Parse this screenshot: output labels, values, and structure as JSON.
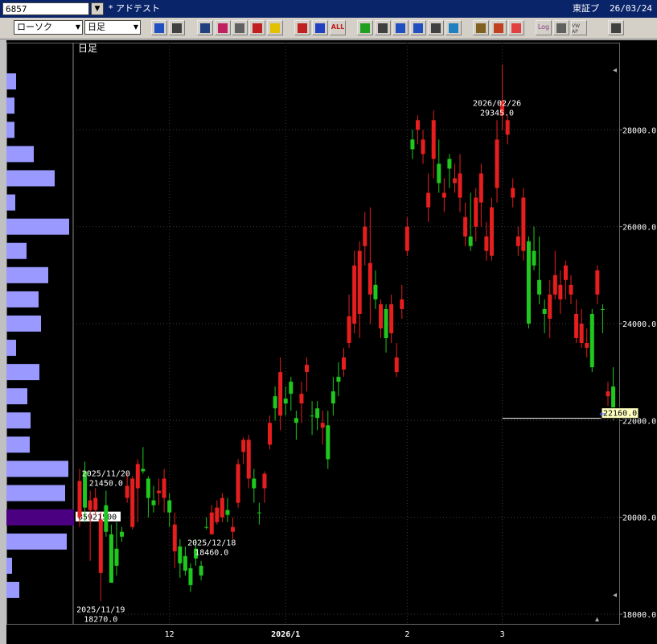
{
  "window": {
    "code": "6857",
    "title": "* アドテスト",
    "market": "東証プ",
    "date": "26/03/24"
  },
  "toolbar": {
    "chart_type": "ローソク",
    "period": "日足",
    "buttons": [
      {
        "name": "zoom-icon",
        "color": "#2050c0"
      },
      {
        "name": "columns-icon",
        "color": "#404040"
      },
      {
        "name": "pointer-icon",
        "color": "#204080"
      },
      {
        "name": "magnifier-icon",
        "color": "#c02060"
      },
      {
        "name": "table-icon",
        "color": "#606060"
      },
      {
        "name": "compare-icon",
        "color": "#c02020"
      },
      {
        "name": "warning-icon",
        "color": "#e0c000"
      },
      {
        "name": "candle-red-icon",
        "color": "#c02020"
      },
      {
        "name": "candle-blue-icon",
        "color": "#2040c0"
      },
      {
        "name": "all-icon",
        "color": "#c02020"
      },
      {
        "name": "pencil-icon",
        "color": "#20a020"
      },
      {
        "name": "line-tool-icon",
        "color": "#404040"
      },
      {
        "name": "cursor-icon",
        "color": "#2050c0"
      },
      {
        "name": "arrow-curve-icon",
        "color": "#2050c0"
      },
      {
        "name": "document-icon",
        "color": "#404040"
      },
      {
        "name": "bucket-icon",
        "color": "#2080c0"
      },
      {
        "name": "settings-icon",
        "color": "#806020"
      },
      {
        "name": "wrench-icon",
        "color": "#c04020"
      },
      {
        "name": "palette-icon",
        "color": "#e04040"
      },
      {
        "name": "log-icon",
        "color": "#804080"
      },
      {
        "name": "nav-icon",
        "color": "#606060"
      },
      {
        "name": "vwap-icon",
        "color": "#404040"
      },
      {
        "name": "layout-icon",
        "color": "#404040"
      }
    ],
    "log_label": "Log",
    "all_label": "ALL",
    "vwap_label": "VW AP"
  },
  "chart_data": {
    "type": "candlestick",
    "period_label": "日足",
    "ylim": [
      17800,
      29800
    ],
    "y_ticks": [
      {
        "v": 18000,
        "label": "18000.0"
      },
      {
        "v": 20000,
        "label": "20000.0"
      },
      {
        "v": 22000,
        "label": "22000.0"
      },
      {
        "v": 24000,
        "label": "24000.0"
      },
      {
        "v": 26000,
        "label": "26000.0"
      },
      {
        "v": 28000,
        "label": "28000.0"
      }
    ],
    "x_ticks": [
      {
        "i": 17,
        "label": "12"
      },
      {
        "i": 39,
        "label": "2026/1"
      },
      {
        "i": 62,
        "label": "2"
      },
      {
        "i": 80,
        "label": "3"
      }
    ],
    "current_price": 22160.0,
    "current_label": "22160.0",
    "volume_profile_label": "85921500",
    "annotations": [
      {
        "date": "2025/11/19",
        "value": "18270.0",
        "i": 4,
        "pos": "below"
      },
      {
        "date": "2025/11/20",
        "value": "21450.0",
        "i": 5,
        "pos": "above"
      },
      {
        "date": "2025/12/18",
        "value": "18460.0",
        "i": 25,
        "pos": "below"
      },
      {
        "date": "2026/02/26",
        "value": "29345.0",
        "i": 79,
        "pos": "above"
      }
    ],
    "candles": [
      [
        20750,
        20000,
        21000,
        19800
      ],
      [
        20200,
        20950,
        21150,
        19900
      ],
      [
        20350,
        20150,
        20550,
        19100
      ],
      [
        20400,
        20150,
        20600,
        20050
      ],
      [
        19950,
        18850,
        20100,
        18270
      ],
      [
        19700,
        20250,
        20550,
        19600
      ],
      [
        18650,
        19650,
        19850,
        18700
      ],
      [
        19000,
        19350,
        19900,
        18800
      ],
      [
        19600,
        19700,
        19800,
        19500
      ],
      [
        20650,
        20400,
        20900,
        20300
      ],
      [
        20800,
        19800,
        20850,
        19750
      ],
      [
        21100,
        20600,
        21200,
        19900
      ],
      [
        20950,
        21000,
        21450,
        20900
      ],
      [
        20400,
        20800,
        20850,
        20000
      ],
      [
        20250,
        20350,
        20650,
        20100
      ],
      [
        20550,
        20500,
        20800,
        20250
      ],
      [
        20800,
        20400,
        21000,
        20100
      ],
      [
        20100,
        20350,
        20500,
        19800
      ],
      [
        19850,
        19300,
        20100,
        18950
      ],
      [
        19050,
        19400,
        19550,
        18750
      ],
      [
        18900,
        19200,
        19400,
        18800
      ],
      [
        18600,
        18950,
        19050,
        18460
      ],
      [
        19150,
        19350,
        19550,
        19000
      ],
      [
        18800,
        19000,
        19100,
        18700
      ],
      [
        19800,
        19800,
        20000,
        19750
      ],
      [
        20100,
        19650,
        20250,
        19650
      ],
      [
        20200,
        19900,
        20350,
        19850
      ],
      [
        20400,
        20000,
        20500,
        19900
      ],
      [
        20050,
        20150,
        20400,
        19900
      ],
      [
        19800,
        19700,
        20000,
        19550
      ],
      [
        21100,
        20300,
        21200,
        20200
      ],
      [
        21600,
        21350,
        21650,
        21100
      ],
      [
        21600,
        20800,
        21700,
        20600
      ],
      [
        20600,
        20800,
        21000,
        20300
      ],
      [
        20100,
        20100,
        20300,
        19850
      ],
      [
        20900,
        20600,
        20950,
        20300
      ],
      [
        21950,
        21500,
        22100,
        21400
      ],
      [
        22250,
        22500,
        22700,
        22000
      ],
      [
        23000,
        22100,
        23300,
        21800
      ],
      [
        22350,
        22450,
        22700,
        22100
      ],
      [
        22550,
        22800,
        22900,
        22200
      ],
      [
        21950,
        22050,
        22200,
        21600
      ],
      [
        22550,
        22350,
        22800,
        21950
      ],
      [
        23150,
        23000,
        23300,
        22600
      ],
      [
        22100,
        22100,
        22400,
        21700
      ],
      [
        22050,
        22250,
        22400,
        21800
      ],
      [
        21950,
        21850,
        22200,
        21500
      ],
      [
        21200,
        21900,
        22200,
        21000
      ],
      [
        22350,
        22600,
        22900,
        22100
      ],
      [
        22800,
        22900,
        23200,
        22500
      ],
      [
        23300,
        23050,
        23500,
        22900
      ],
      [
        24150,
        23600,
        24600,
        23500
      ],
      [
        25200,
        24000,
        25500,
        23800
      ],
      [
        25500,
        24200,
        25700,
        23700
      ],
      [
        26000,
        25600,
        26300,
        25200
      ],
      [
        25250,
        24600,
        26400,
        24000
      ],
      [
        24500,
        24800,
        25100,
        24300
      ],
      [
        24400,
        23900,
        24500,
        23700
      ],
      [
        23700,
        24300,
        24400,
        23400
      ],
      [
        24400,
        23800,
        24600,
        23600
      ],
      [
        23300,
        23000,
        23600,
        22900
      ],
      [
        24500,
        24300,
        24800,
        24100
      ],
      [
        26000,
        25500,
        26200,
        25400
      ],
      [
        27600,
        27800,
        28000,
        27400
      ],
      [
        28200,
        28000,
        28300,
        27700
      ],
      [
        27800,
        27500,
        28000,
        27300
      ],
      [
        26700,
        26400,
        27100,
        26100
      ],
      [
        28200,
        27400,
        28400,
        27000
      ],
      [
        26900,
        27300,
        27800,
        26700
      ],
      [
        26700,
        26600,
        27000,
        26300
      ],
      [
        27200,
        27400,
        27500,
        26800
      ],
      [
        27000,
        26900,
        27300,
        26700
      ],
      [
        27100,
        26600,
        27500,
        26300
      ],
      [
        26200,
        25800,
        26500,
        25600
      ],
      [
        25600,
        25800,
        26700,
        25500
      ],
      [
        26600,
        26000,
        26800,
        25700
      ],
      [
        27100,
        26500,
        27300,
        26000
      ],
      [
        25800,
        25500,
        26100,
        25300
      ],
      [
        26400,
        25400,
        26600,
        25300
      ],
      [
        27800,
        26800,
        28200,
        26500
      ],
      [
        28600,
        28300,
        29345,
        28000
      ],
      [
        28200,
        27900,
        28300,
        27700
      ],
      [
        26800,
        26600,
        27000,
        26400
      ],
      [
        25800,
        25600,
        26000,
        25400
      ],
      [
        26600,
        25500,
        26800,
        25300
      ],
      [
        24000,
        25700,
        25800,
        23900
      ],
      [
        25200,
        25500,
        26000,
        25100
      ],
      [
        24600,
        24900,
        25800,
        24400
      ],
      [
        24200,
        24300,
        24500,
        23800
      ],
      [
        24600,
        24100,
        24900,
        23700
      ],
      [
        25000,
        24600,
        25500,
        24500
      ],
      [
        24800,
        24500,
        25100,
        24200
      ],
      [
        25200,
        24900,
        25300,
        24500
      ],
      [
        24800,
        24600,
        25000,
        24400
      ],
      [
        24200,
        23700,
        24500,
        23600
      ],
      [
        24000,
        23600,
        24300,
        23500
      ],
      [
        23600,
        23500,
        23900,
        23300
      ],
      [
        23100,
        24200,
        24300,
        23000
      ],
      [
        25100,
        24600,
        25200,
        24400
      ],
      [
        24300,
        24300,
        24400,
        23800
      ],
      [
        22600,
        22500,
        22800,
        22300
      ],
      [
        22100,
        22700,
        23100,
        22000
      ]
    ],
    "volume_profile": [
      {
        "price": 29000,
        "len": 12
      },
      {
        "price": 28500,
        "len": 10
      },
      {
        "price": 28000,
        "len": 10
      },
      {
        "price": 27500,
        "len": 34
      },
      {
        "price": 27000,
        "len": 60
      },
      {
        "price": 26500,
        "len": 11
      },
      {
        "price": 26000,
        "len": 78
      },
      {
        "price": 25500,
        "len": 25
      },
      {
        "price": 25000,
        "len": 52
      },
      {
        "price": 24500,
        "len": 40
      },
      {
        "price": 24000,
        "len": 43
      },
      {
        "price": 23500,
        "len": 12
      },
      {
        "price": 23000,
        "len": 41
      },
      {
        "price": 22500,
        "len": 26
      },
      {
        "price": 22000,
        "len": 30
      },
      {
        "price": 21500,
        "len": 29
      },
      {
        "price": 21000,
        "len": 77
      },
      {
        "price": 20500,
        "len": 73
      },
      {
        "price": 20000,
        "len": 84,
        "highlight": true
      },
      {
        "price": 19500,
        "len": 75
      },
      {
        "price": 19000,
        "len": 7
      },
      {
        "price": 18500,
        "len": 16
      }
    ],
    "colors": {
      "up": "#1ec81e",
      "down": "#e61e1e",
      "grid": "#3a3a3a",
      "profile": "#9999ff",
      "profile_highlight": "#4b0082",
      "price_tag_bg": "#ffffc0"
    }
  }
}
